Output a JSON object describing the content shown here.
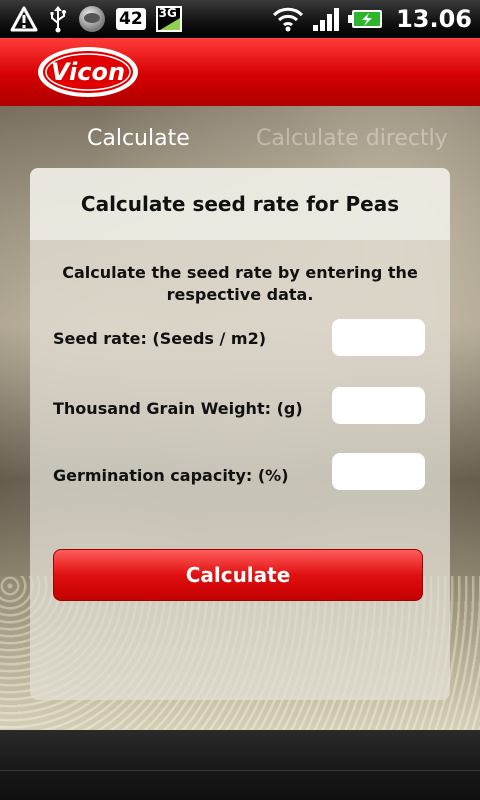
{
  "status_bar": {
    "icons": [
      "warning-icon",
      "usb-icon",
      "app-circle-icon",
      "notification-count-icon",
      "3g-icon",
      "wifi-icon",
      "signal-icon",
      "battery-charging-icon"
    ],
    "notification_count": "42",
    "network_label": "3G",
    "time": "13.06"
  },
  "header": {
    "brand": "Vicon",
    "brand_color": "#d40000"
  },
  "tabs": [
    {
      "label": "Calculate",
      "active": true
    },
    {
      "label": "Calculate directly",
      "active": false
    }
  ],
  "panel": {
    "title": "Calculate seed rate for Peas",
    "intro": "Calculate the seed rate by entering the respective data.",
    "fields": [
      {
        "label": "Seed rate: (Seeds / m2)",
        "value": ""
      },
      {
        "label": "Thousand Grain Weight: (g)",
        "value": ""
      },
      {
        "label": "Germination capacity: (%)",
        "value": ""
      }
    ],
    "button_label": "Calculate"
  }
}
